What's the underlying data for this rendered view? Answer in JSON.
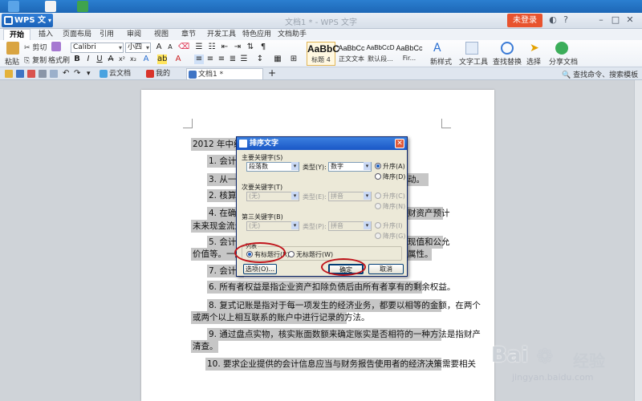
{
  "app": {
    "menu_label": "WPS 文字",
    "doc_title": "文档1 * - WPS 文字",
    "login_label": "未登录"
  },
  "ribbon_tabs": [
    "开始",
    "插入",
    "页面布局",
    "引用",
    "审阅",
    "视图",
    "章节",
    "开发工具",
    "特色应用",
    "文档助手"
  ],
  "ribbon": {
    "paste": "粘贴",
    "cut": "剪切",
    "copy": "复制",
    "format_painter": "格式刷",
    "font_name": "Calibri",
    "font_size": "小四",
    "bold": "B",
    "italic": "I",
    "underline": "U",
    "styles": [
      {
        "sample": "AaBbC",
        "name": "标题 4"
      },
      {
        "sample": "AaBbCc",
        "name": "正文文本"
      },
      {
        "sample": "AaBbCcD",
        "name": "默认段..."
      },
      {
        "sample": "AaBbCc",
        "name": "Fir..."
      }
    ],
    "new_style": "新样式",
    "text_tools": "文字工具",
    "find_replace": "查找替换",
    "select": "选择",
    "share_doc": "分享文档"
  },
  "docbar": {
    "tabs": [
      "云文档",
      "我的WPS",
      "文档1 *"
    ],
    "help_search": "查找命令、搜索模板"
  },
  "document": {
    "lines": [
      "2012  年中级",
      "1.    会计",
      "3.    从一",
      "2.    核算",
      "4.    在确",
      "未来现金流量",
      "5.    会计",
      "价值等。一般",
      "7.    会计",
      "6.    所有者权益是指企业资产扣除负债后由所有者享有的剩余权益。",
      "8.    复式记账是指对于每一项发生的经济业务，都要以相等的金额，在两个",
      "或两个以上相互联系的账户中进行记录的方法。",
      "9.    通过盘点实物，核实账面数额来确定账实是否相符的一种方法是指财产",
      "清查。",
      "10.    要求企业提供的会计信息应当与财务报告使用者的经济决策需要相关"
    ],
    "right_fragments": [
      "动。",
      "财资产预计",
      "现值和公允",
      "属性。"
    ]
  },
  "dialog": {
    "title": "排序文字",
    "primary_key_label": "主要关键字(S)",
    "primary_key_value": "段落数",
    "type_label_1": "类型(Y):",
    "type_value_1": "数字",
    "asc_label": "升序(A)",
    "desc_label": "降序(D)",
    "secondary_key_label": "次要关键字(T)",
    "secondary_key_value": "(无)",
    "type_label_2": "类型(E):",
    "type_value_2": "拼音",
    "asc_label_2": "升序(C)",
    "desc_label_2": "降序(N)",
    "third_key_label": "第三关键字(B)",
    "third_key_value": "(无)",
    "type_label_3": "类型(P):",
    "type_value_3": "拼音",
    "asc_label_3": "升序(I)",
    "desc_label_3": "降序(G)",
    "list_label": "列表",
    "header_row": "有标题行(R)",
    "no_header_row": "无标题行(W)",
    "options_button": "选项(O)...",
    "ok_button": "确定",
    "cancel_button": "取消"
  },
  "watermark": {
    "brand": "Bai",
    "brand_cn": "经验",
    "url": "jingyan.baidu.com"
  },
  "colors": {
    "accent": "#1b62b8",
    "login": "#e8532e",
    "highlight_ring": "#c0141b",
    "selection": "#c6c6c6"
  }
}
